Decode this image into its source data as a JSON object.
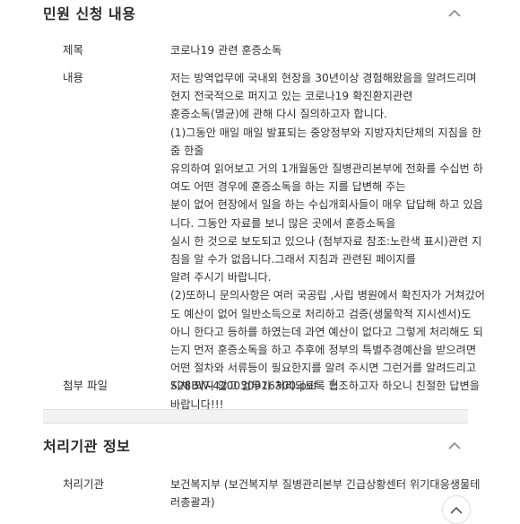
{
  "section1": {
    "title": "민원 신청 내용",
    "subject_label": "제목",
    "subject_value": "코로나19 관련 훈증소독",
    "content_label": "내용",
    "content_lines": [
      "저는 방역업무에 국내외 현장을 30년이상 경험해왔음을 알려드리며",
      "현지 전국적으로 퍼지고 있는 코로나19 확진환지관련",
      "훈증소독(멸균)에 관해 다시 질의하고자 합니다.",
      "(1)그동안 매일 매일 발표되는 중앙정부와 지방자치단체의 지침을 한",
      "줌 한줄",
      "유의하여 읽어보고 거의 1개월동안 질병관리본부에 전화를 수십번 하",
      "여도 어떤 경우에 훈증소독을 하는 지를 답변해 주는",
      "분이 없어 현장에서 일을 하는 수십개회사들이 매우 답답해 하고 있읍",
      "니다. 그동안 자료를 보니 많은 곳에서 훈증소독을",
      "실시 한 것으로 보도되고 있으나 (첨부자료 참조:노란색 표시)관련 지",
      "침을 알 수가 없읍니다.그래서 지침과 관련된 페이지를",
      "알려 주시기 바랍니다.",
      "(2)또하니 문의사항은 여러 국공립 ,사립 병원에서 확진자가 거쳐갔어",
      "도 예산이 없어 일반소득으로 처리하고 검증(생물학적 지시센서)도",
      "아니 한다고 등하를 하였는데 과연 예산이 없다고 그렇게 처리해도 되",
      "는지 먼저 훈증소독을 하고 추후에 정부의 특별추경예산을 받으려면",
      "어떤 절차와 서류등이 필요한지를 알려 주시면 그런거를 알려드리고",
      "지체 되지 않고 업무가 처리되도록 협조하고자 하오니 친절한 답변을",
      "바랍니다!!!"
    ],
    "attachment_label": "첨부 파일",
    "attachment_value": "S28BW-420030916300.pdf",
    "download_icon": "download-icon"
  },
  "section2": {
    "title": "처리기관 정보",
    "agency_label": "처리기관",
    "agency_lines": [
      "보건복지부 (보건복지부 질병관리본부 긴급상황센터 위기대응생물테",
      "러총괄과)"
    ]
  },
  "icons": {
    "collapse": "chevron-up-icon",
    "scroll_top": "chevron-up-icon"
  }
}
